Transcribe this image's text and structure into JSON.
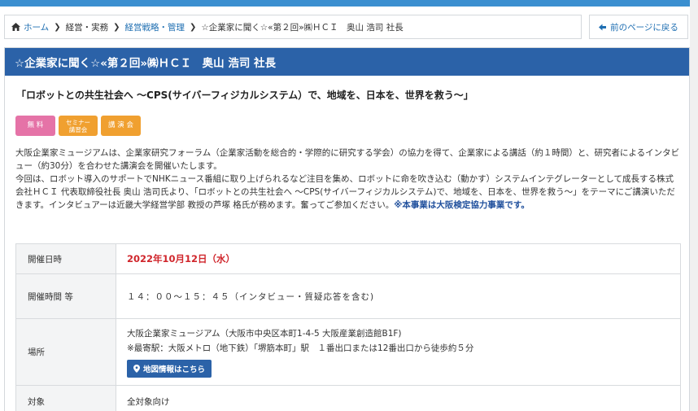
{
  "breadcrumb": {
    "items": [
      "ホーム",
      "経営・実務",
      "経営戦略・管理",
      "☆企業家に聞く☆«第２回»㈱ＨＣＩ　奥山 浩司 社長"
    ]
  },
  "back_button": {
    "label": "前のページに戻る"
  },
  "event": {
    "title": "☆企業家に聞く☆«第２回»㈱ＨＣＩ　奥山 浩司 社長",
    "subtitle": "「ロボットとの共生社会へ ～CPS(サイバーフィジカルシステム）で、地域を、日本を、世界を救う～」",
    "tags": {
      "free": "無 料",
      "seminar_line1": "セミナー",
      "seminar_line2": "講習会",
      "lecture": "講 演 会"
    },
    "description_1": "大阪企業家ミュージアムは、企業家研究フォーラム（企業家活動を総合的・学際的に研究する学会）の協力を得て、企業家による講話（約１時間）と、研究者によるインタビュー（約30分）を合わせた講演会を開催いたします。",
    "description_2": "今回は、ロボット導入のサポートでNHKニュース番組に取り上げられるなど注目を集め、ロボットに命を吹き込む（動かす）システムインテグレーターとして成長する株式会社ＨＣＩ 代表取締役社長 奥山 浩司氏より、「ロボットとの共生社会へ ～CPS(サイバーフィジカルシステム)で、地域を、日本を、世界を救う～」をテーマにご講演いただきます。インタビュアーは近畿大学経営学部 教授の芦塚 格氏が務めます。奮ってご参加ください。",
    "description_note": "※本事業は大阪検定協力事業です。"
  },
  "details": {
    "date_label": "開催日時",
    "date_value": "2022年10月12日（水）",
    "time_label": "開催時間 等",
    "time_value": "１４：００～１５：４５（インタビュー・質疑応答を含む)",
    "venue_label": "場所",
    "venue_line1": "大阪企業家ミュージアム（大阪市中央区本町1-4-5 大阪産業創造館B1F)",
    "venue_line2": "※最寄駅：大阪メトロ（地下鉄）「堺筋本町」駅　１番出口または12番出口から徒歩約５分",
    "map_button": "地図情報はこちら",
    "target_label": "対象",
    "target_value": "全対象向け"
  },
  "colors": {
    "accent": "#2b62a8",
    "link": "#1f6fb2",
    "date_red": "#d0262c",
    "tag_pink": "#e573a7",
    "tag_orange": "#f0a030"
  }
}
